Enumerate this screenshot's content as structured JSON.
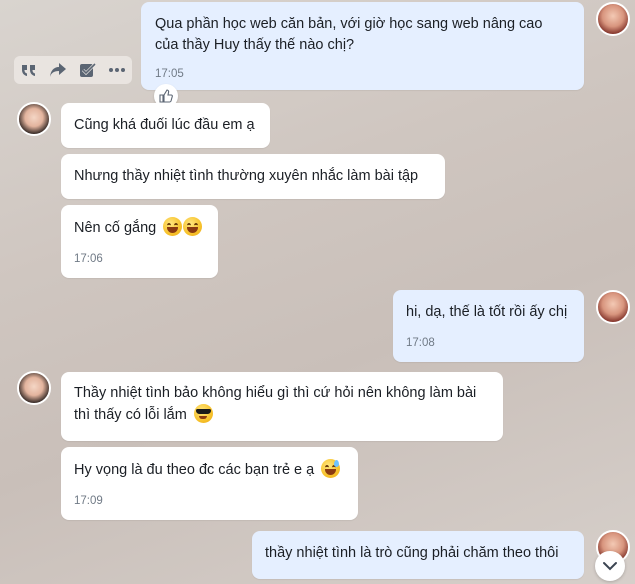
{
  "messages": [
    {
      "text": "Qua phần học web căn bản, với giờ học sang web nâng cao của thầy Huy thấy thế nào chị?",
      "time": "17:05"
    },
    {
      "text": "Cũng khá đuối lúc đầu em ạ"
    },
    {
      "text": "Nhưng thầy nhiệt tình thường xuyên nhắc làm bài tập"
    },
    {
      "text": "Nên cố gắng",
      "time": "17:06"
    },
    {
      "text": "hi, dạ, thế là tốt rồi ấy chị",
      "time": "17:08"
    },
    {
      "text": "Thầy nhiệt tình bảo không hiểu gì thì cứ hỏi nên không làm bài thì thấy có lỗi lắm"
    },
    {
      "text": "Hy vọng là đu theo đc các bạn trẻ e ạ",
      "time": "17:09"
    },
    {
      "text": "thầy nhiệt tình là trò cũng phải chăm theo thôi"
    }
  ],
  "icons": {
    "toolbar": [
      "quote-icon",
      "share-icon",
      "task-icon",
      "more-icon"
    ],
    "reaction": "thumbs-up-icon",
    "scroll": "chevron-down-icon",
    "emoji": [
      "grinning-emoji",
      "grinning-emoji",
      "sunglasses-emoji",
      "sweat-smile-emoji"
    ]
  },
  "colors": {
    "incoming_bubble": "#ffffff",
    "outgoing_bubble": "#e5efff",
    "time_text": "#707a86"
  }
}
